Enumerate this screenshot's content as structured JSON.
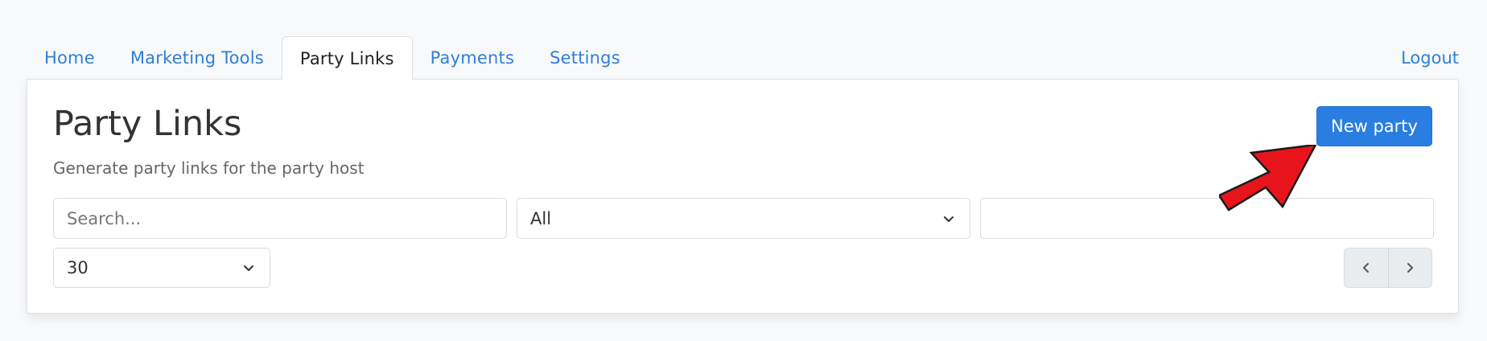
{
  "nav": {
    "tabs": [
      {
        "label": "Home"
      },
      {
        "label": "Marketing Tools"
      },
      {
        "label": "Party Links"
      },
      {
        "label": "Payments"
      },
      {
        "label": "Settings"
      }
    ],
    "active_tab": "Party Links",
    "logout_label": "Logout"
  },
  "page": {
    "title": "Party Links",
    "subtitle": "Generate party links for the party host",
    "new_button_label": "New party"
  },
  "filters": {
    "search_placeholder": "Search...",
    "status_value": "All",
    "text_value": "",
    "page_size_value": "30"
  },
  "icons": {
    "select_chevron": "chevron-down-icon",
    "prev": "chevron-left-icon",
    "next": "chevron-right-icon",
    "annotation": "red-arrow-icon"
  },
  "colors": {
    "accent": "#2a7de1",
    "link": "#2f7fd8",
    "annotation": "#e8141c"
  }
}
